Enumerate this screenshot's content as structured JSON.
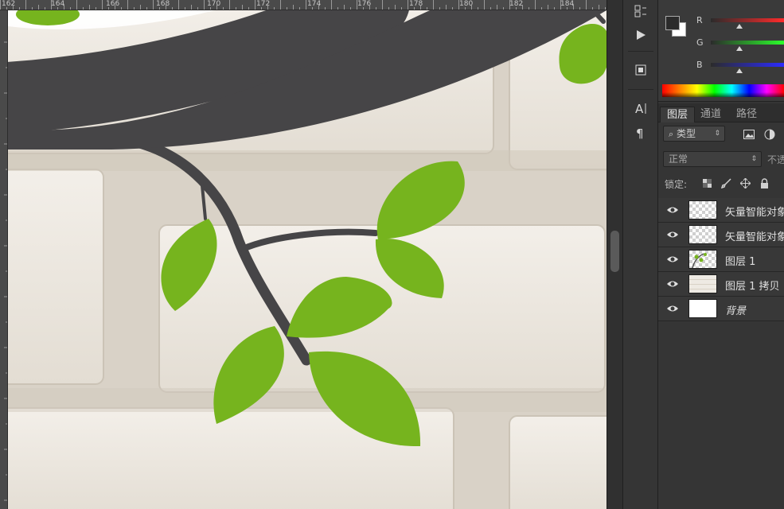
{
  "ruler": {
    "top_labels": [
      "162",
      "164",
      "166",
      "168",
      "170",
      "172",
      "174",
      "176",
      "178",
      "180",
      "182",
      "184"
    ]
  },
  "color_panel": {
    "labels": {
      "r": "R",
      "g": "G",
      "b": "B"
    },
    "foreground": "#2b2b2b",
    "background": "#ffffff"
  },
  "layers_panel": {
    "tabs": [
      {
        "label": "图层",
        "active": true
      },
      {
        "label": "通道",
        "active": false
      },
      {
        "label": "路径",
        "active": false
      }
    ],
    "filter": {
      "label": "类型"
    },
    "blend": {
      "value": "正常",
      "opacity_label": "不透"
    },
    "lock": {
      "label": "锁定:"
    },
    "layers": [
      {
        "name": "矢量智能对象",
        "thumb": "checker",
        "italic": false
      },
      {
        "name": "矢量智能对象",
        "thumb": "checker",
        "italic": false
      },
      {
        "name": "图层 1",
        "thumb": "tree",
        "italic": false
      },
      {
        "name": "图层 1 拷贝",
        "thumb": "brick",
        "italic": false
      },
      {
        "name": "背景",
        "thumb": "white",
        "italic": true
      }
    ]
  },
  "colors": {
    "leaf": "#76b41e",
    "branch": "#464547",
    "brick": "#ece7df",
    "mortar": "#d6cfc3"
  }
}
